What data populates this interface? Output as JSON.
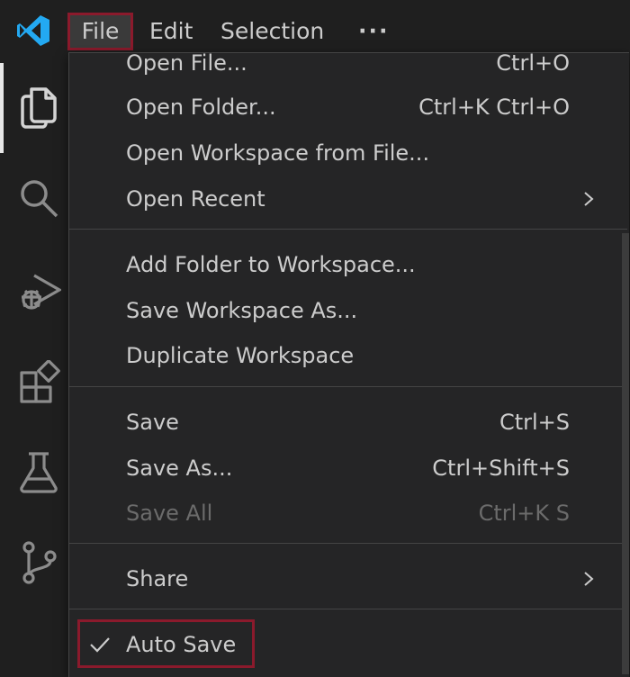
{
  "titlebar": {
    "app_icon": "vscode-logo-icon",
    "menu": {
      "file": "File",
      "edit": "Edit",
      "selection": "Selection",
      "more": "···"
    }
  },
  "activitybar": {
    "icons": [
      "explorer-icon",
      "search-icon",
      "run-debug-icon",
      "extensions-icon",
      "testing-icon",
      "source-control-icon"
    ]
  },
  "file_menu": {
    "open_file": {
      "label": "Open File...",
      "shortcut": "Ctrl+O"
    },
    "open_folder": {
      "label": "Open Folder...",
      "shortcut": "Ctrl+K Ctrl+O"
    },
    "open_workspace": {
      "label": "Open Workspace from File..."
    },
    "open_recent": {
      "label": "Open Recent"
    },
    "add_folder": {
      "label": "Add Folder to Workspace..."
    },
    "save_workspace_as": {
      "label": "Save Workspace As..."
    },
    "duplicate_workspace": {
      "label": "Duplicate Workspace"
    },
    "save": {
      "label": "Save",
      "shortcut": "Ctrl+S"
    },
    "save_as": {
      "label": "Save As...",
      "shortcut": "Ctrl+Shift+S"
    },
    "save_all": {
      "label": "Save All",
      "shortcut": "Ctrl+K S",
      "disabled": true
    },
    "share": {
      "label": "Share"
    },
    "auto_save": {
      "label": "Auto Save",
      "checked": true
    }
  },
  "colors": {
    "highlight": "#8b1a2c",
    "background": "#1f1f1f",
    "menu_bg": "#252526",
    "vscode_blue": "#23a9f2"
  }
}
